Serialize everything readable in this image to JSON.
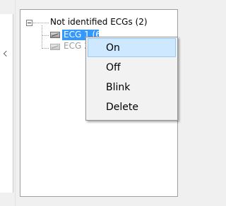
{
  "tree": {
    "root": {
      "label": "Not identified ECGs (2)",
      "expanded": true
    },
    "nodes": [
      {
        "label": "ECG 1 (6)",
        "selected": true,
        "icon": "ecg-icon"
      },
      {
        "label": "ECG 2",
        "selected": false,
        "icon": "ecg-icon"
      }
    ]
  },
  "context_menu": {
    "items": [
      {
        "label": "On",
        "highlighted": true
      },
      {
        "label": "Off",
        "highlighted": false
      },
      {
        "label": "Blink",
        "highlighted": false
      },
      {
        "label": "Delete",
        "highlighted": false
      }
    ]
  },
  "colors": {
    "selection": "#3399ff",
    "menu_highlight": "#cde8ff",
    "menu_highlight_border": "#99c9f5",
    "disabled_text": "#9c9c9c"
  }
}
